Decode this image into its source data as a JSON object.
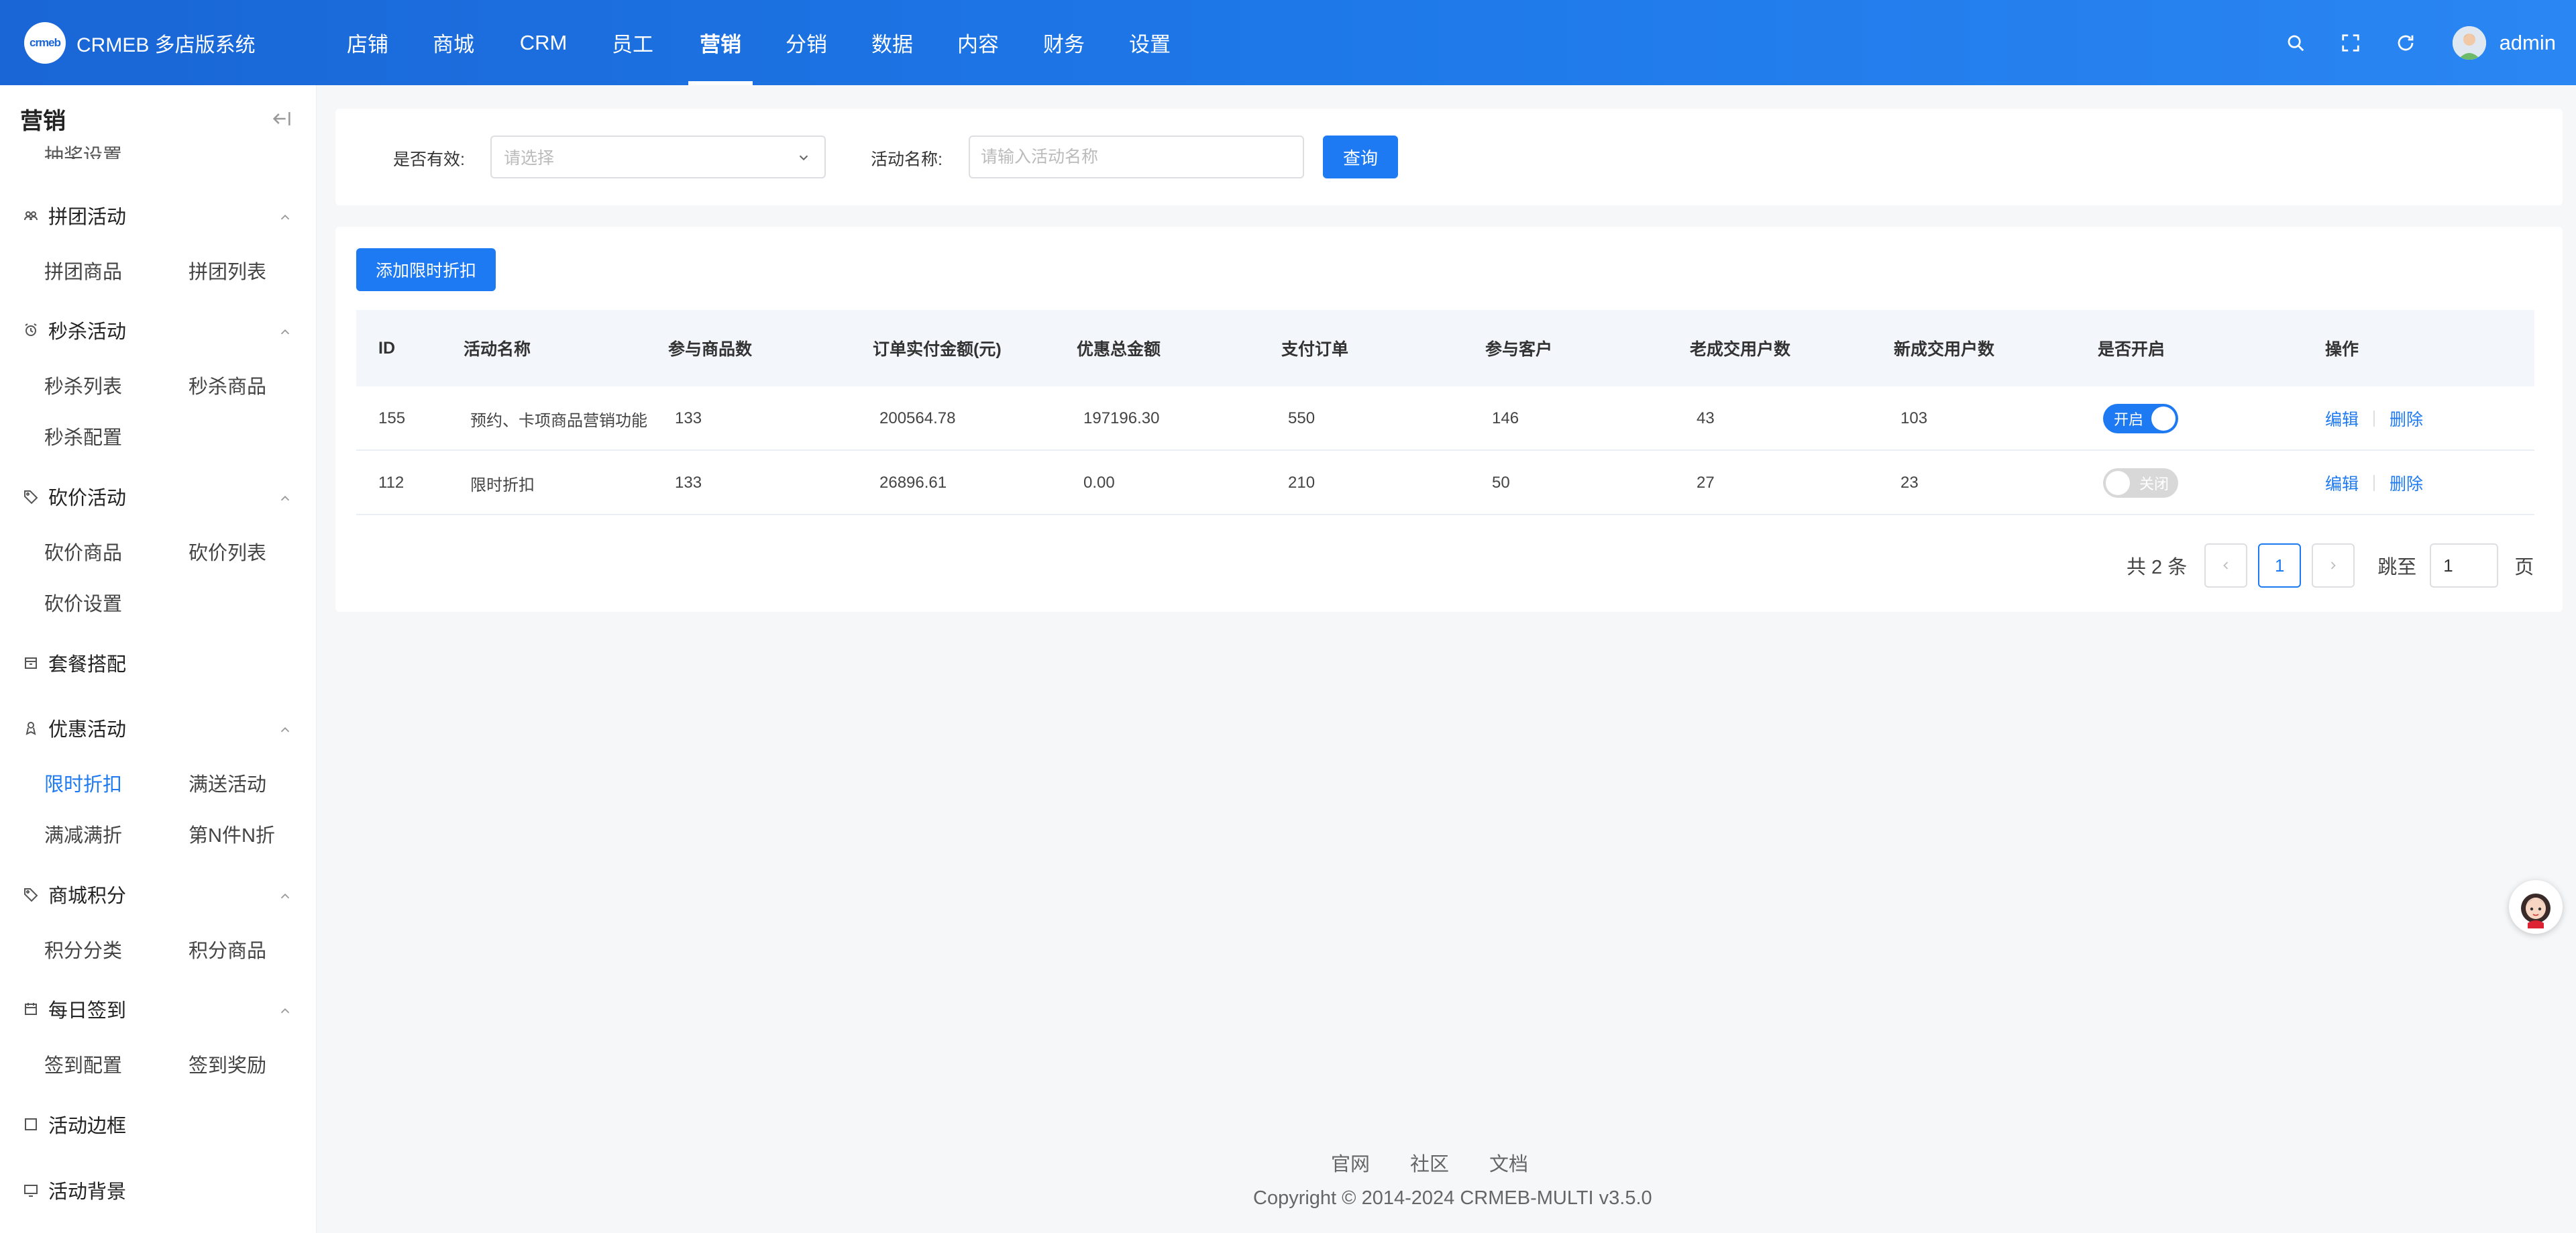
{
  "app": {
    "logo_text": "crmeb",
    "title": "CRMEB 多店版系统"
  },
  "topnav": [
    "店铺",
    "商城",
    "CRM",
    "员工",
    "营销",
    "分销",
    "数据",
    "内容",
    "财务",
    "设置"
  ],
  "topnav_active": "营销",
  "user": {
    "name": "admin"
  },
  "sidebar": {
    "title": "营销",
    "cut_item": "抽奖设置",
    "groups": [
      {
        "title": "拼团活动",
        "icon": "group-icon",
        "items": [
          "拼团商品",
          "拼团列表"
        ]
      },
      {
        "title": "秒杀活动",
        "icon": "alarm-clock-icon",
        "items": [
          "秒杀列表",
          "秒杀商品",
          "秒杀配置"
        ]
      },
      {
        "title": "砍价活动",
        "icon": "tag-icon",
        "items": [
          "砍价商品",
          "砍价列表",
          "砍价设置"
        ]
      },
      {
        "title": "套餐搭配",
        "icon": "package-icon",
        "items": []
      },
      {
        "title": "优惠活动",
        "icon": "discount-icon",
        "items": [
          "限时折扣",
          "满送活动",
          "满减满折",
          "第N件N折"
        ]
      },
      {
        "title": "商城积分",
        "icon": "tag-icon",
        "items": [
          "积分分类",
          "积分商品"
        ]
      },
      {
        "title": "每日签到",
        "icon": "calendar-icon",
        "items": [
          "签到配置",
          "签到奖励"
        ]
      },
      {
        "title": "活动边框",
        "icon": "frame-icon",
        "items": []
      },
      {
        "title": "活动背景",
        "icon": "background-icon",
        "items": []
      }
    ],
    "active_item": "限时折扣"
  },
  "filters": {
    "valid_label": "是否有效:",
    "valid_placeholder": "请选择",
    "name_label": "活动名称:",
    "name_placeholder": "请输入活动名称",
    "query_button": "查询"
  },
  "add_button": "添加限时折扣",
  "table": {
    "columns": [
      "ID",
      "活动名称",
      "参与商品数",
      "订单实付金额(元)",
      "优惠总金额",
      "支付订单",
      "参与客户",
      "老成交用户数",
      "新成交用户数",
      "是否开启",
      "操作"
    ],
    "rows": [
      {
        "id": "155",
        "name": "预约、卡项商品营销功能",
        "products": "133",
        "paid": "200564.78",
        "discount": "197196.30",
        "orders": "550",
        "customers": "146",
        "old_users": "43",
        "new_users": "103",
        "enabled": true,
        "switch_text": "开启"
      },
      {
        "id": "112",
        "name": "限时折扣",
        "products": "133",
        "paid": "26896.61",
        "discount": "0.00",
        "orders": "210",
        "customers": "50",
        "old_users": "27",
        "new_users": "23",
        "enabled": false,
        "switch_text": "关闭"
      }
    ],
    "actions": {
      "edit": "编辑",
      "delete": "删除"
    }
  },
  "pagination": {
    "total": "共 2 条",
    "current": "1",
    "jump_label": "跳至",
    "jump_value": "1",
    "page_suffix": "页"
  },
  "footer": {
    "links": [
      "官网",
      "社区",
      "文档"
    ],
    "copyright": "Copyright © 2014-2024 CRMEB-MULTI v3.5.0"
  },
  "colors": {
    "primary": "#1d7af2",
    "header_start": "#1a66d6",
    "header_end": "#2a86f2"
  }
}
